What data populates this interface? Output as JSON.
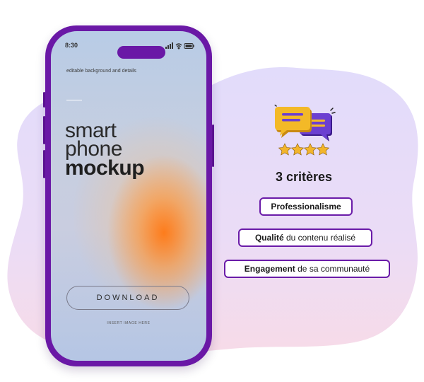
{
  "phone": {
    "status_time": "8:30",
    "caption": "editable background and details",
    "headline": [
      "smart",
      "phone",
      "mockup"
    ],
    "download_label": "DOWNLOAD",
    "insert_label": "INSERT IMAGE HERE"
  },
  "criteria": {
    "title": "3 critères",
    "items": [
      {
        "bold": "Professionalisme",
        "rest": ""
      },
      {
        "bold": "Qualité",
        "rest": " du contenu réalisé"
      },
      {
        "bold": "Engagement",
        "rest": " de sa communauté"
      }
    ],
    "icon": "chat-bubbles-rating-icon",
    "rating_stars": 4
  },
  "colors": {
    "accent": "#6a18a6",
    "blob_top": "#e3ddfb",
    "blob_bottom": "#f5dbe9",
    "star": "#f2b52c",
    "bubble_yellow": "#f3b927",
    "bubble_purple": "#6b3fd1"
  }
}
